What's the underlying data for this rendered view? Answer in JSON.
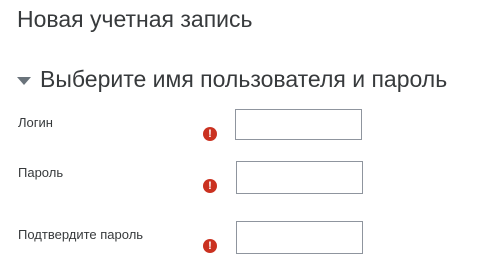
{
  "page": {
    "title": "Новая учетная запись"
  },
  "section": {
    "title": "Выберите имя пользователя и пароль",
    "expanded": true
  },
  "fields": [
    {
      "label": "Логин",
      "value": "",
      "required": true
    },
    {
      "label": "Пароль",
      "value": "",
      "required": true
    },
    {
      "label": "Подтвердите пароль",
      "value": "",
      "required": true
    }
  ],
  "icons": {
    "required": "exclamation-circle-icon",
    "collapse": "caret-down-icon"
  },
  "colors": {
    "required_icon": "#ca3120",
    "text": "#373a3c",
    "input_border": "#8f959e"
  },
  "required_glyph": "!"
}
